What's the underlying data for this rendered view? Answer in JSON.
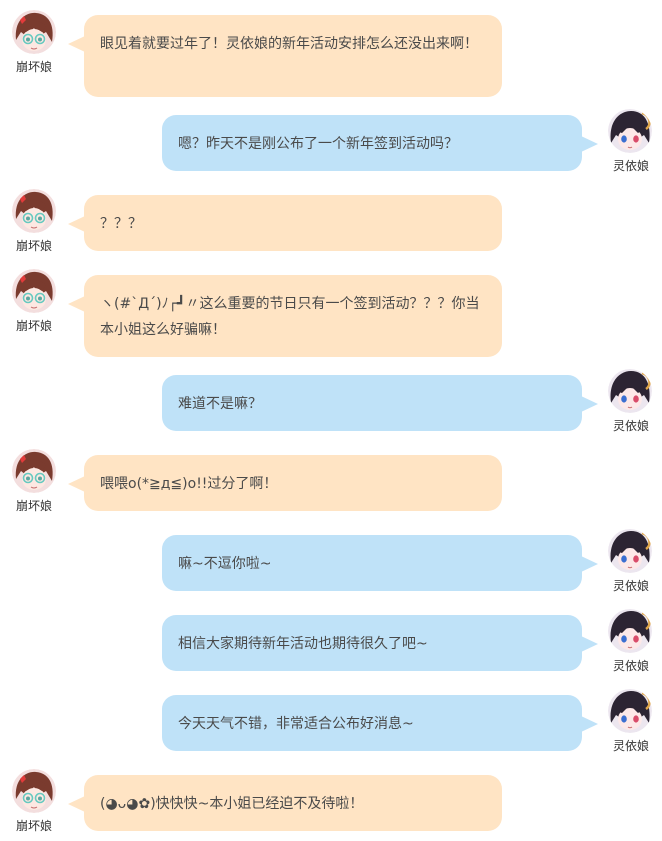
{
  "characters": {
    "honkai": {
      "name": "崩坏娘",
      "hair_color": "#7a3b2e",
      "skin_color": "#fde8e2",
      "accent": "#e23b3b",
      "glasses": "#67c9c0"
    },
    "lingyi": {
      "name": "灵依娘",
      "hair_color": "#2c2433",
      "skin_color": "#fde8e8",
      "accent": "#e0a64a",
      "eye": "#d94c6a"
    }
  },
  "colors": {
    "left_bubble": "#ffe4c4",
    "right_bubble": "#bfe2f8",
    "text": "#4a4a4a",
    "name": "#333333"
  },
  "messages": [
    {
      "side": "left",
      "character": "honkai",
      "name": "崩坏娘",
      "text": "眼见着就要过年了！灵依娘的新年活动安排怎么还没出来啊！"
    },
    {
      "side": "right",
      "character": "lingyi",
      "name": "灵依娘",
      "text": "嗯？昨天不是刚公布了一个新年签到活动吗？"
    },
    {
      "side": "left",
      "character": "honkai",
      "name": "崩坏娘",
      "text": "？？？"
    },
    {
      "side": "left",
      "character": "honkai",
      "name": "崩坏娘",
      "text": "ヽ(#`Д´)ﾉ┌┛〃这么重要的节日只有一个签到活动？？？你当本小姐这么好骗嘛！"
    },
    {
      "side": "right",
      "character": "lingyi",
      "name": "灵依娘",
      "text": "难道不是嘛？"
    },
    {
      "side": "left",
      "character": "honkai",
      "name": "崩坏娘",
      "text": "喂喂o(*≧д≦)o!!过分了啊！"
    },
    {
      "side": "right",
      "character": "lingyi",
      "name": "灵依娘",
      "text": "嘛~不逗你啦~"
    },
    {
      "side": "right",
      "character": "lingyi",
      "name": "灵依娘",
      "text": "相信大家期待新年活动也期待很久了吧~"
    },
    {
      "side": "right",
      "character": "lingyi",
      "name": "灵依娘",
      "text": "今天天气不错，非常适合公布好消息~"
    },
    {
      "side": "left",
      "character": "honkai",
      "name": "崩坏娘",
      "text": "(◕ᴗ◕✿)快快快~本小姐已经迫不及待啦！"
    }
  ]
}
